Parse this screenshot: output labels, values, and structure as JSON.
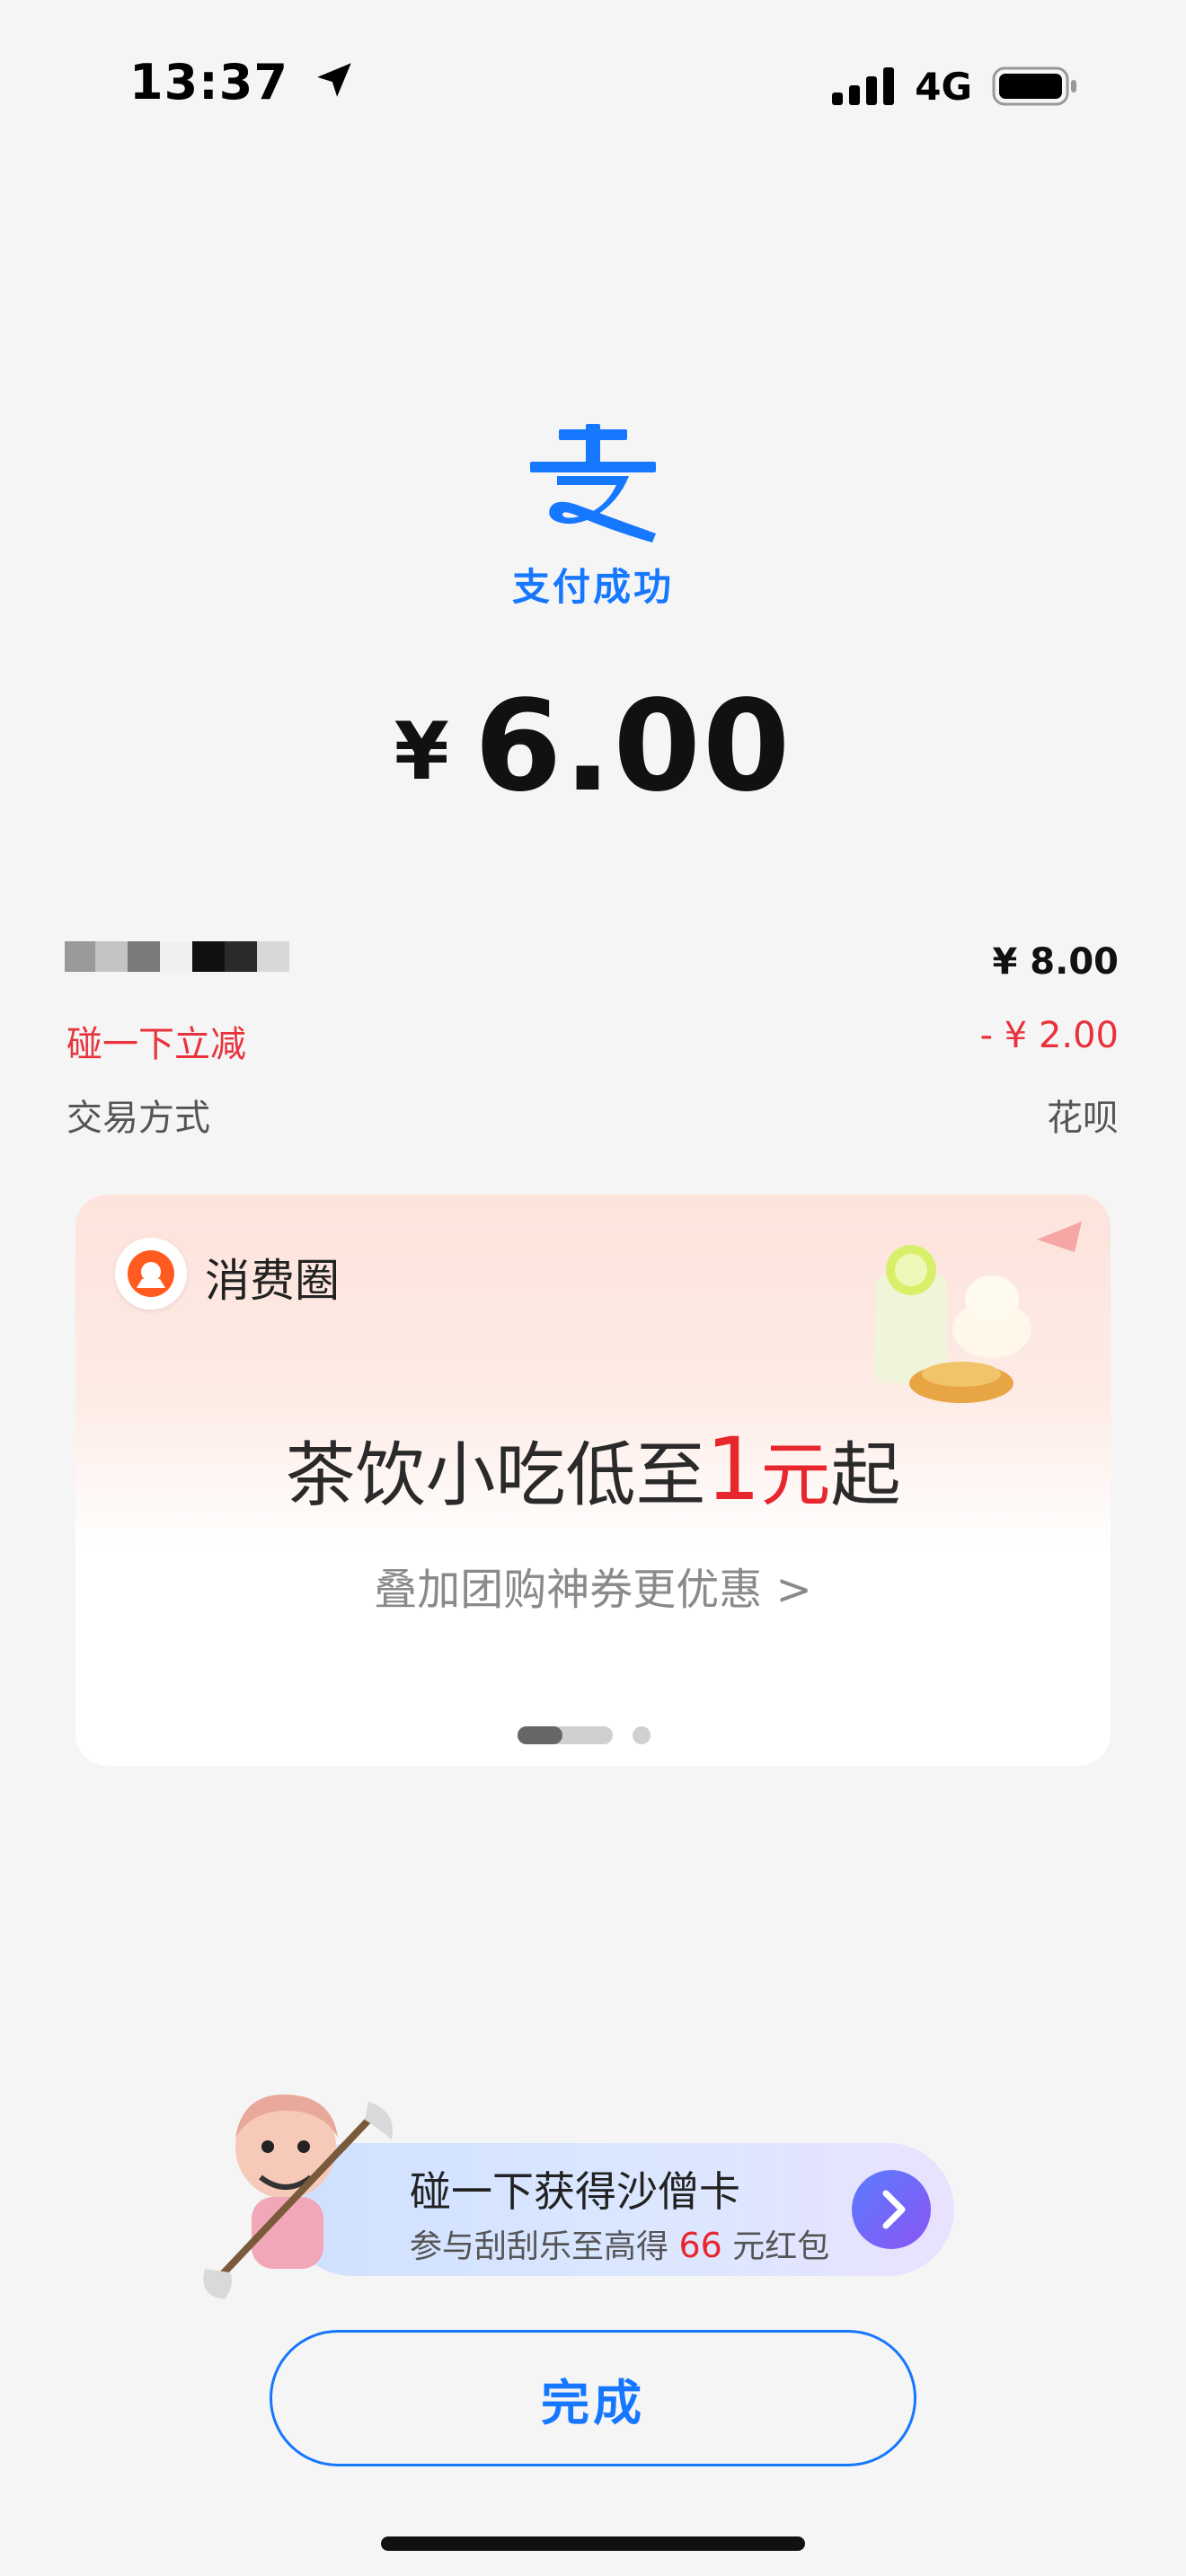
{
  "status_bar": {
    "time": "13:37",
    "network": "4G"
  },
  "header": {
    "status_text": "支付成功",
    "currency_symbol": "¥",
    "amount": "6.00"
  },
  "details": {
    "original_price": "¥ 8.00",
    "discount_label": "碰一下立减",
    "discount_value": "- ¥ 2.00",
    "payment_method_label": "交易方式",
    "payment_method_value": "花呗"
  },
  "promo_card": {
    "brand": "消费圈",
    "headline_prefix": "茶饮小吃低至",
    "headline_highlight": "1",
    "headline_unit": "元",
    "headline_suffix": "起",
    "sub_text": "叠加团购神券更优惠 >"
  },
  "banner": {
    "title": "碰一下获得沙僧卡",
    "sub_prefix": "参与刮刮乐至高得",
    "sub_number": "66",
    "sub_suffix": "元红包"
  },
  "done_button": {
    "label": "完成"
  },
  "colors": {
    "accent": "#1677ff",
    "discount_red": "#e8323c",
    "background": "#f5f5f5"
  }
}
